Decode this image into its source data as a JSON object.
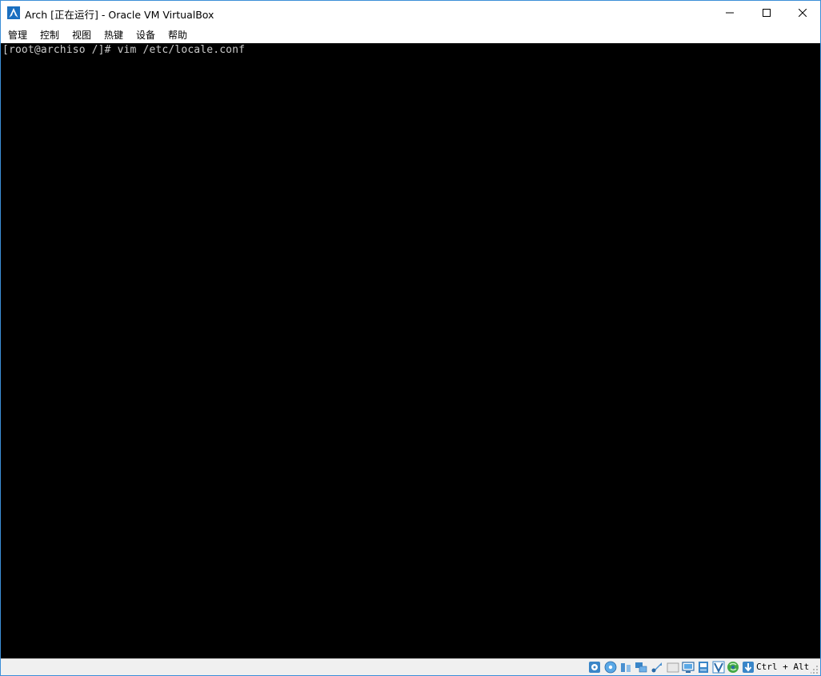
{
  "window": {
    "title": "Arch [正在运行] - Oracle VM VirtualBox",
    "app_icon": "arch-linux-icon",
    "controls": {
      "minimize_icon": "minimize-icon",
      "maximize_icon": "maximize-icon",
      "close_icon": "close-icon"
    }
  },
  "menubar": {
    "items": [
      {
        "label": "管理"
      },
      {
        "label": "控制"
      },
      {
        "label": "视图"
      },
      {
        "label": "热键"
      },
      {
        "label": "设备"
      },
      {
        "label": "帮助"
      }
    ]
  },
  "console": {
    "lines": [
      "[root@archiso /]# vim /etc/locale.conf"
    ]
  },
  "statusbar": {
    "icons": [
      "hard-disk-icon",
      "optical-drive-icon",
      "audio-icon",
      "network-icon",
      "usb-icon",
      "shared-folders-icon",
      "display-icon",
      "recording-icon",
      "virtualization-engine-icon",
      "mouse-integration-icon",
      "keyboard-capture-icon"
    ],
    "host_key": "Ctrl + Alt"
  },
  "colors": {
    "window_border": "#3c8fd8",
    "console_background": "#000000",
    "console_text": "#c9c9c9",
    "statusbar_background": "#f0f0f0"
  }
}
